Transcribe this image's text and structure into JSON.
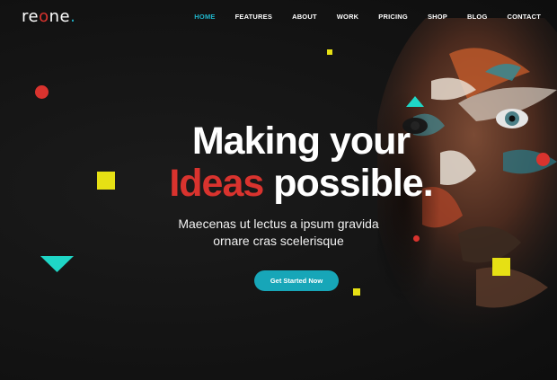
{
  "brand": {
    "prefix": "re",
    "o": "o",
    "suffix": "ne",
    "dot": "."
  },
  "nav": {
    "items": [
      "HOME",
      "FEATURES",
      "ABOUT",
      "WORK",
      "PRICING",
      "SHOP",
      "BLOG",
      "CONTACT"
    ],
    "active": "HOME"
  },
  "hero": {
    "line1": "Making your",
    "line2_accent": "Ideas",
    "line2_rest": "possible.",
    "subtitle_line1": "Maecenas ut lectus a ipsum gravida",
    "subtitle_line2": "ornare cras scelerisque",
    "cta_label": "Get Started Now"
  },
  "colors": {
    "background": "#141414",
    "accent_red": "#d9332e",
    "accent_teal": "#1fb4c9",
    "accent_yellow": "#e6e014",
    "button": "#17a6b8"
  },
  "icons": [
    "red-circle-icon",
    "yellow-square-icon",
    "teal-triangle-icon"
  ]
}
